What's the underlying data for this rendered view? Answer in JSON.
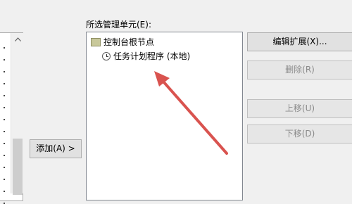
{
  "left_panel": {
    "add_button_label": "添加(A) >"
  },
  "selected_panel": {
    "label": "所选管理单元(E):",
    "tree": {
      "root_label": "控制台根节点",
      "child_label": "任务计划程序 (本地)"
    }
  },
  "actions": {
    "edit_extensions_label": "编辑扩展(X)...",
    "remove_label": "删除(R)",
    "move_up_label": "上移(U)",
    "move_down_label": "下移(D)"
  },
  "annotation": {
    "arrow_color": "#d9534f"
  }
}
